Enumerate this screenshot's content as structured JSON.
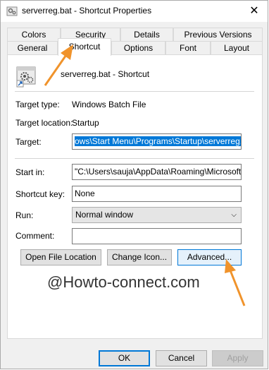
{
  "window": {
    "title": "serverreg.bat - Shortcut Properties",
    "close_glyph": "✕"
  },
  "tabs": {
    "row1": [
      "Colors",
      "Security",
      "Details",
      "Previous Versions"
    ],
    "row2": [
      "General",
      "Shortcut",
      "Options",
      "Font",
      "Layout"
    ],
    "selected": "Shortcut"
  },
  "header": {
    "file_label": "serverreg.bat - Shortcut",
    "icon": "gear-shortcut-icon"
  },
  "fields": {
    "target_type_label": "Target type:",
    "target_type_value": "Windows Batch File",
    "target_location_label": "Target location:",
    "target_location_value": "Startup",
    "target_label": "Target:",
    "target_value": "ows\\Start Menu\\Programs\\Startup\\serverreg.bat\"",
    "start_in_label": "Start in:",
    "start_in_value": "\"C:\\Users\\sauja\\AppData\\Roaming\\Microsoft\\W",
    "shortcut_key_label": "Shortcut key:",
    "shortcut_key_value": "None",
    "run_label": "Run:",
    "run_value": "Normal window",
    "comment_label": "Comment:",
    "comment_value": ""
  },
  "buttons": {
    "open_file_location": "Open File Location",
    "change_icon": "Change Icon...",
    "advanced": "Advanced...",
    "ok": "OK",
    "cancel": "Cancel",
    "apply": "Apply"
  },
  "watermark": "@Howto-connect.com",
  "colors": {
    "accent": "#0078d7",
    "arrow": "#f0932b"
  }
}
